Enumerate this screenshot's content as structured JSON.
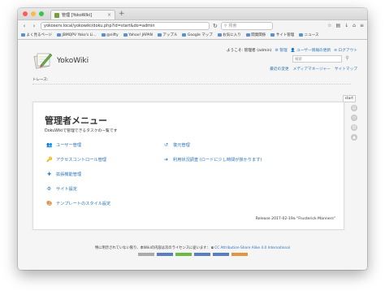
{
  "browser": {
    "tab_title": "管理 [YokoWiki]",
    "url": "yokoserv.local/yokowiki/doku.php?id=start&do=admin",
    "web_search_placeholder": "検索",
    "bookmarks": [
      "よく見るページ",
      "JBMQPV Yoko's Li...",
      "@nifty",
      "Yahoo! JAPAN",
      "アップル",
      "Google マップ",
      "お気に入り",
      "開発関係",
      "サイト管理",
      "ニュース"
    ]
  },
  "wiki": {
    "title": "YokoWiki",
    "user_greeting": "ようこそ: 管理者 (admin)",
    "admin_link": "管理",
    "profile_link": "ユーザー情報の更新",
    "logout_link": "ログアウト",
    "search_placeholder": "検索",
    "recent_changes": "最近の変更",
    "media_manager": "メディアマネージャー",
    "sitemap": "サイトマップ",
    "trace_label": "トレース:",
    "start_tab": "start"
  },
  "admin": {
    "title": "管理者メニュー",
    "description": "DokuWikiで管理できるタスクの一覧です",
    "items": [
      {
        "label": "ユーザー管理",
        "icon": "users-icon"
      },
      {
        "label": "アクセスコントロール管理",
        "icon": "key-icon"
      },
      {
        "label": "拡張機能管理",
        "icon": "puzzle-icon"
      },
      {
        "label": "サイト設定",
        "icon": "gear-icon"
      },
      {
        "label": "テンプレートのスタイル設定",
        "icon": "palette-icon"
      },
      {
        "label": "復元管理",
        "icon": "revert-icon"
      },
      {
        "label": "利用状況調査 (ロードに少し時間が掛かります)",
        "icon": "arrow-right-icon"
      }
    ],
    "release": "Release 2017-02-19a \"Frusterick Manners\""
  },
  "footer": {
    "license_text": "特に明示されていない限り、本Wikiの内容は次のライセンスに従います：",
    "license_link": "CC Attribution-Share Alike 4.0 International"
  },
  "colors": {
    "link": "#2b73b7",
    "bg": "#f5f5f5"
  }
}
